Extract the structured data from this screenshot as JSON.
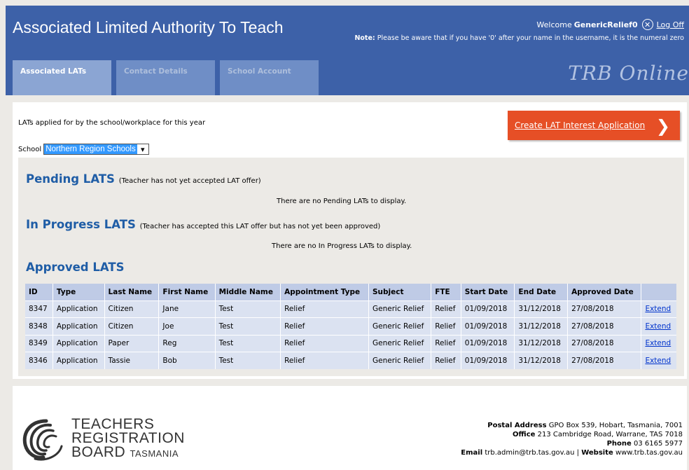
{
  "header": {
    "title": "Associated Limited Authority To Teach",
    "welcome_prefix": "Welcome",
    "username": "GenericRelief0",
    "logout_label": "Log Off",
    "note_label": "Note:",
    "note_text": "Please be aware that if you have '0' after your name in the username, it is the numeral zero",
    "brand": "TRB Online",
    "tabs": [
      {
        "label": "Associated LATs",
        "active": true
      },
      {
        "label": "Contact Details",
        "active": false
      },
      {
        "label": "School Account",
        "active": false
      }
    ]
  },
  "main": {
    "intro": "LATs applied for by the school/workplace for this year",
    "create_button": "Create LAT Interest Application",
    "school_label": "School",
    "school_value": "Northern Region Schools",
    "pending": {
      "title": "Pending LATS",
      "subtitle": "(Teacher has not yet accepted LAT offer)",
      "empty": "There are no Pending LATs to display."
    },
    "in_progress": {
      "title": "In Progress LATS",
      "subtitle": "(Teacher has accepted this LAT offer but has not yet been approved)",
      "empty": "There are no In Progress LATs to display."
    },
    "approved": {
      "title": "Approved LATS",
      "columns": [
        "ID",
        "Type",
        "Last Name",
        "First Name",
        "Middle Name",
        "Appointment Type",
        "Subject",
        "FTE",
        "Start Date",
        "End Date",
        "Approved Date",
        ""
      ],
      "rows": [
        [
          "8347",
          "Application",
          "Citizen",
          "Jane",
          "Test",
          "Relief",
          "Generic Relief",
          "Relief",
          "01/09/2018",
          "31/12/2018",
          "27/08/2018",
          "Extend"
        ],
        [
          "8348",
          "Application",
          "Citizen",
          "Joe",
          "Test",
          "Relief",
          "Generic Relief",
          "Relief",
          "01/09/2018",
          "31/12/2018",
          "27/08/2018",
          "Extend"
        ],
        [
          "8349",
          "Application",
          "Paper",
          "Reg",
          "Test",
          "Relief",
          "Generic Relief",
          "Relief",
          "01/09/2018",
          "31/12/2018",
          "27/08/2018",
          "Extend"
        ],
        [
          "8346",
          "Application",
          "Tassie",
          "Bob",
          "Test",
          "Relief",
          "Generic Relief",
          "Relief",
          "01/09/2018",
          "31/12/2018",
          "27/08/2018",
          "Extend"
        ]
      ]
    }
  },
  "footer": {
    "logo_line1": "TEACHERS",
    "logo_line2": "REGISTRATION",
    "logo_line3a": "BOARD",
    "logo_line3b": "TASMANIA",
    "postal_label": "Postal Address",
    "postal_value": "GPO Box 539, Hobart, Tasmania, 7001",
    "office_label": "Office",
    "office_value": "213 Cambridge Road, Warrane, TAS 7018",
    "phone_label": "Phone",
    "phone_value": "03 6165 5977",
    "email_label": "Email",
    "email_value": "trb.admin@trb.tas.gov.au",
    "separator": "|",
    "website_label": "Website",
    "website_value": "www.trb.tas.gov.au"
  },
  "icons": {
    "logout": "circle-x-icon",
    "create_arrow": "chevron-right-icon",
    "dropdown": "chevron-down-icon"
  },
  "colors": {
    "header_bg": "#3d61a8",
    "accent_button": "#e64f26",
    "section_title": "#1f5da6",
    "table_header": "#bfcbe6",
    "table_row": "#dbe2f1"
  }
}
